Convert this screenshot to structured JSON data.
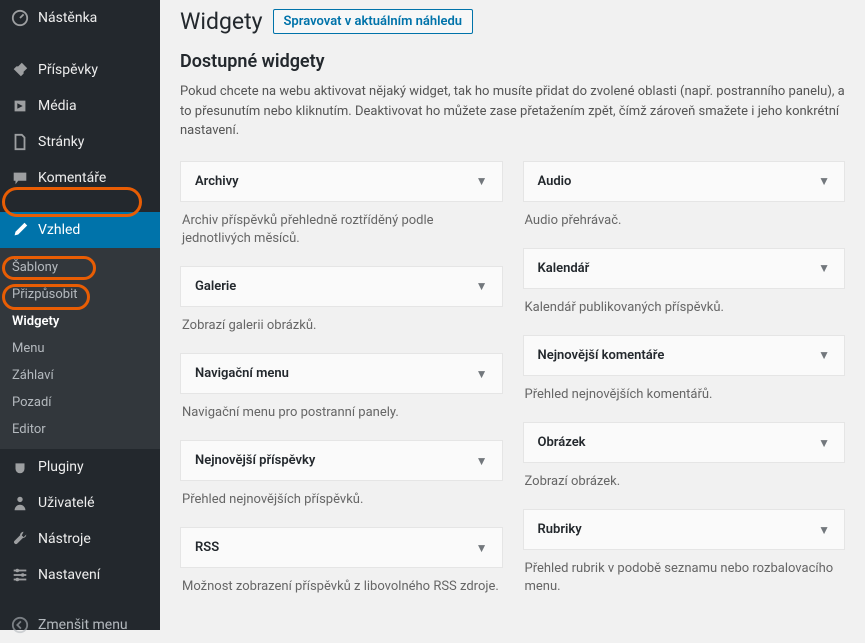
{
  "sidebar": {
    "items": [
      {
        "label": "Nástěnka",
        "icon": "dashboard"
      },
      {
        "label": "Příspěvky",
        "icon": "pin"
      },
      {
        "label": "Média",
        "icon": "media"
      },
      {
        "label": "Stránky",
        "icon": "pages"
      },
      {
        "label": "Komentáře",
        "icon": "comments"
      },
      {
        "label": "Vzhled",
        "icon": "brush",
        "active": true
      },
      {
        "label": "Pluginy",
        "icon": "plugin"
      },
      {
        "label": "Uživatelé",
        "icon": "users"
      },
      {
        "label": "Nástroje",
        "icon": "tools"
      },
      {
        "label": "Nastavení",
        "icon": "settings"
      },
      {
        "label": "Zmenšit menu",
        "icon": "collapse"
      }
    ],
    "submenu": [
      {
        "label": "Šablony"
      },
      {
        "label": "Přizpůsobit"
      },
      {
        "label": "Widgety",
        "current": true
      },
      {
        "label": "Menu"
      },
      {
        "label": "Záhlaví"
      },
      {
        "label": "Pozadí"
      },
      {
        "label": "Editor"
      }
    ]
  },
  "page": {
    "title": "Widgety",
    "action": "Spravovat v aktuálním náhledu",
    "section_title": "Dostupné widgety",
    "section_desc": "Pokud chcete na webu aktivovat nějaký widget, tak ho musíte přidat do zvolené oblasti (např. postranního panelu), a to přesunutím nebo kliknutím. Deaktivovat ho můžete zase přetažením zpět, čímž zároveň smažete i jeho konkrétní nastavení."
  },
  "widgets": {
    "left": [
      {
        "title": "Archivy",
        "desc": "Archiv příspěvků přehledně roztříděný podle jednotlivých měsíců."
      },
      {
        "title": "Galerie",
        "desc": "Zobrazí galerii obrázků."
      },
      {
        "title": "Navigační menu",
        "desc": "Navigační menu pro postranní panely."
      },
      {
        "title": "Nejnovější příspěvky",
        "desc": "Přehled nejnovějších příspěvků."
      },
      {
        "title": "RSS",
        "desc": "Možnost zobrazení příspěvků z libovolného RSS zdroje."
      }
    ],
    "right": [
      {
        "title": "Audio",
        "desc": "Audio přehrávač."
      },
      {
        "title": "Kalendář",
        "desc": "Kalendář publikovaných příspěvků."
      },
      {
        "title": "Nejnovější komentáře",
        "desc": "Přehled nejnovějších komentářů."
      },
      {
        "title": "Obrázek",
        "desc": "Zobrazí obrázek."
      },
      {
        "title": "Rubriky",
        "desc": "Přehled rubrik v podobě seznamu nebo rozbalovacího menu."
      }
    ]
  }
}
